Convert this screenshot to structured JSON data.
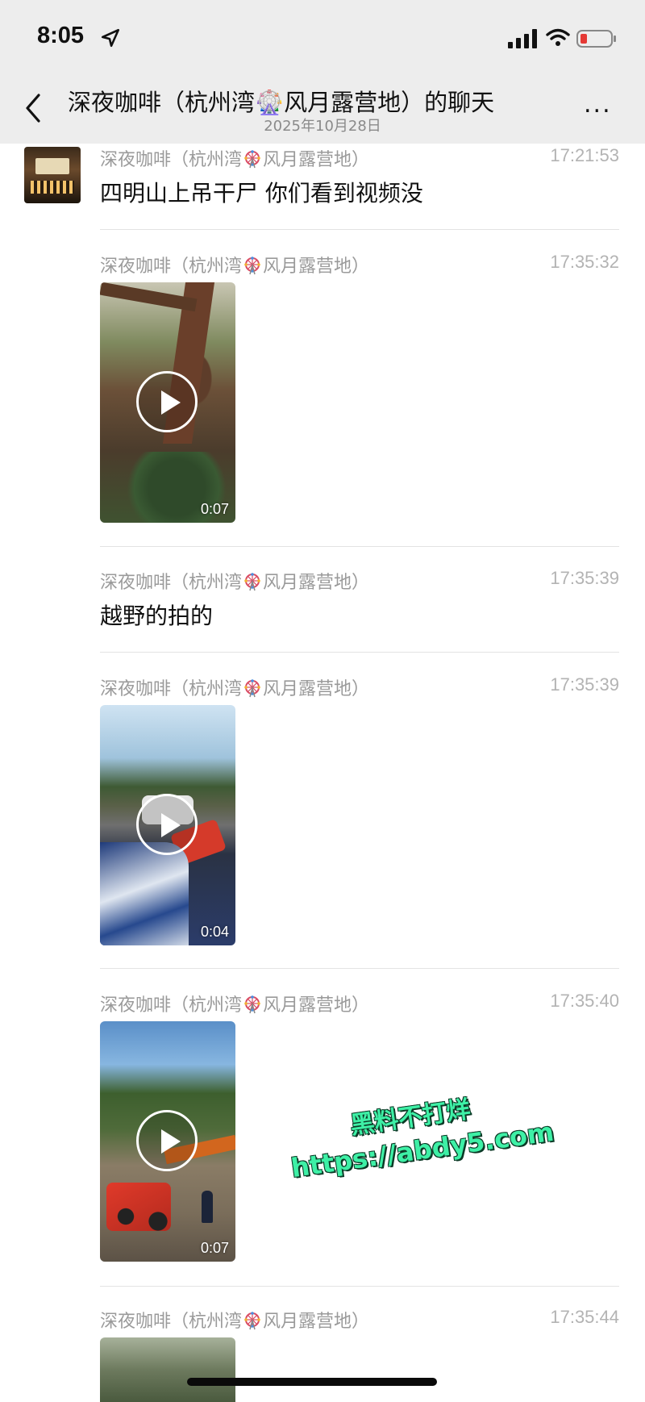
{
  "status_bar": {
    "time": "8:05"
  },
  "header": {
    "title": "深夜咖啡（杭州湾🎡风月露营地）的聊天",
    "subtitle": "2025年10月28日",
    "more": "..."
  },
  "sender_parts": {
    "before": "深夜咖啡（杭州湾",
    "after": "风月露营地）"
  },
  "messages": [
    {
      "time": "17:21:53",
      "text": "四明山上吊干尸  你们看到视频没"
    },
    {
      "time": "17:35:32",
      "duration": "0:07"
    },
    {
      "time": "17:35:39",
      "text": "越野的拍的"
    },
    {
      "time": "17:35:39",
      "duration": "0:04"
    },
    {
      "time": "17:35:40",
      "duration": "0:07"
    },
    {
      "time": "17:35:44"
    }
  ],
  "watermark": {
    "line1": "黑料不打烊",
    "line2": "https://abdy5.com"
  },
  "colors": {
    "header_bg": "#ededed",
    "meta_text": "#9a9a9a",
    "watermark": "#3ef0a6"
  }
}
